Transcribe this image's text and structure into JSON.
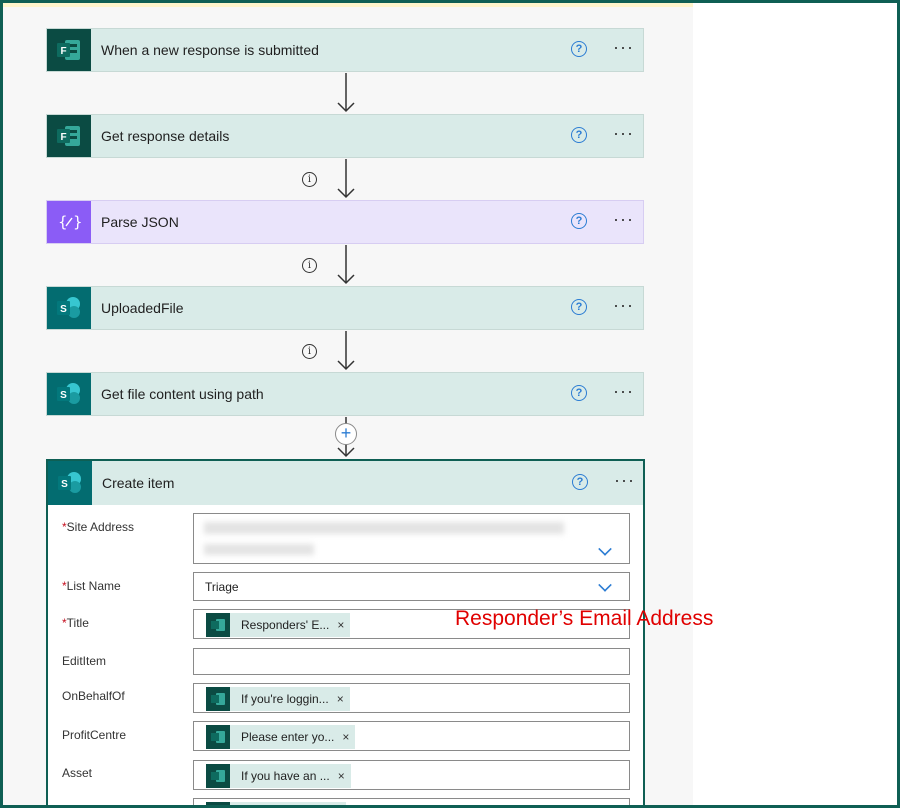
{
  "flow_steps": [
    {
      "title": "When a new response is submitted",
      "icon": "forms-icon",
      "color": "#d9ebe8"
    },
    {
      "title": "Get response details",
      "icon": "forms-icon",
      "color": "#d9ebe8"
    },
    {
      "title": "Parse JSON",
      "icon": "json-icon",
      "color": "#eae4fb"
    },
    {
      "title": "UploadedFile",
      "icon": "sharepoint-icon",
      "color": "#d9ebe8"
    },
    {
      "title": "Get file content using path",
      "icon": "sharepoint-icon",
      "color": "#d9ebe8"
    }
  ],
  "create_item": {
    "title": "Create item",
    "fields": {
      "site_address": {
        "label": "Site Address",
        "required": true,
        "value_line1": "",
        "value_line2": ""
      },
      "list_name": {
        "label": "List Name",
        "required": true,
        "value": "Triage"
      },
      "title": {
        "label": "Title",
        "required": true,
        "token": "Responders' E..."
      },
      "edit_item": {
        "label": "EditItem",
        "required": false,
        "value": ""
      },
      "on_behalf_of": {
        "label": "OnBehalfOf",
        "required": false,
        "token": "If you're loggin..."
      },
      "profit_centre": {
        "label": "ProfitCentre",
        "required": false,
        "token": "Please enter yo..."
      },
      "asset": {
        "label": "Asset",
        "required": false,
        "token": "If you have an ..."
      }
    }
  },
  "annotation": "Responder’s Email Address",
  "glyphs": {
    "required_mark": "*",
    "help": "?",
    "more": "···",
    "info": "i",
    "remove": "×",
    "plus": "+"
  }
}
